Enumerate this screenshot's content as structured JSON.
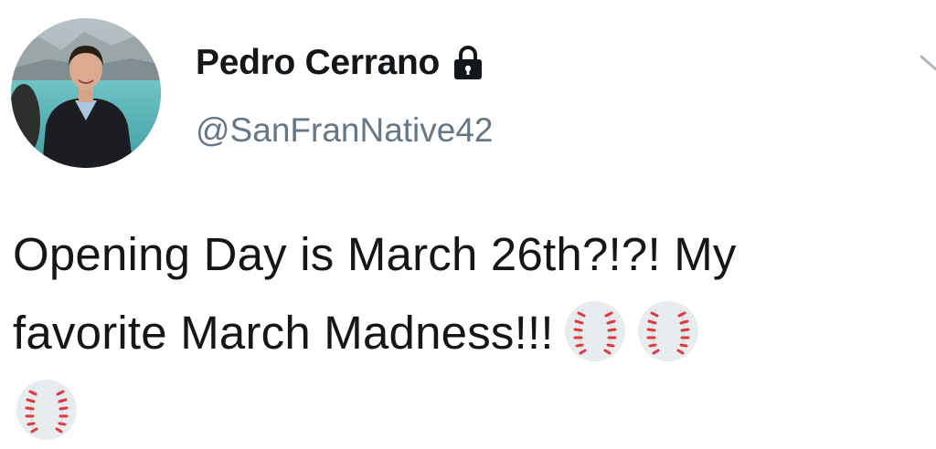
{
  "author": {
    "display_name": "Pedro Cerrano",
    "handle": "@SanFranNative42",
    "protected_account_icon": "lock-icon",
    "avatar": "profile-photo"
  },
  "tweet": {
    "line1": "Opening Day is March 26th?!?! My",
    "line2": "favorite March Madness!!!",
    "emoji": [
      "baseball",
      "baseball",
      "baseball"
    ]
  },
  "menu_icon": "chevron-down-icon",
  "colors": {
    "text": "#14171a",
    "secondary_text": "#657786",
    "baseball_stitch": "#e0393e",
    "background": "#ffffff"
  }
}
